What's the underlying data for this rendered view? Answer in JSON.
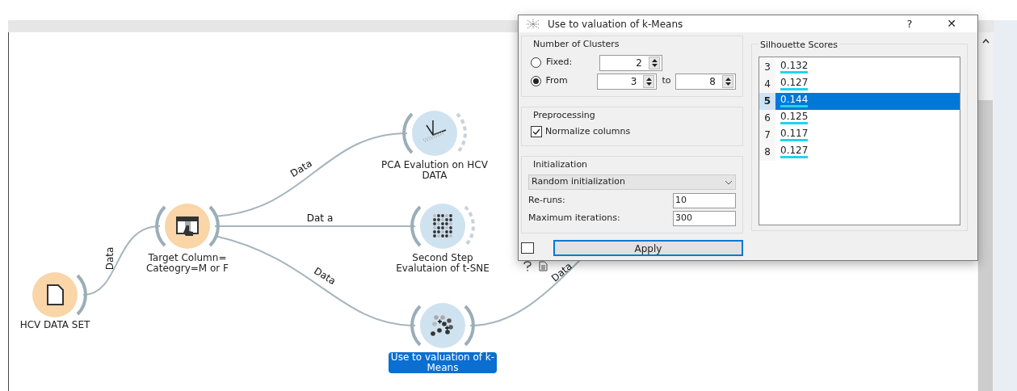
{
  "canvas": {
    "nodes": [
      {
        "kind": "file",
        "label": "HCV DATA SET",
        "selected": false
      },
      {
        "kind": "select",
        "label": "Target Column=\nCateogry=M or F",
        "selected": false
      },
      {
        "kind": "pca",
        "label": "PCA Evalution on HCV\nDATA",
        "selected": false
      },
      {
        "kind": "tsne",
        "label": "Second Step\nEvalutaion of t-SNE",
        "selected": false
      },
      {
        "kind": "kmeans",
        "label": "Use to valuation of k-\nMeans",
        "selected": true
      }
    ],
    "links": [
      {
        "label": "Data"
      },
      {
        "label": "Data"
      },
      {
        "label": "Dat a"
      },
      {
        "label": "Data"
      },
      {
        "label": "Data"
      }
    ]
  },
  "dialog": {
    "title": "Use to valuation of k-Means",
    "help": "?",
    "close": "✕",
    "clusters": {
      "title": "Number of Clusters",
      "fixed": {
        "label": "Fixed:",
        "selected": false,
        "value": "2"
      },
      "from": {
        "label": "From",
        "selected": true,
        "value": "3",
        "to_label": "to",
        "to_value": "8"
      }
    },
    "preprocessing": {
      "title": "Preprocessing",
      "normalize": {
        "label": "Normalize columns",
        "checked": true
      }
    },
    "initialization": {
      "title": "Initialization",
      "method": "Random initialization",
      "reruns": {
        "label": "Re-runs:",
        "value": "10"
      },
      "max_iterations": {
        "label": "Maximum iterations:",
        "value": "300"
      }
    },
    "auto_apply": {
      "checked": false
    },
    "apply": "Apply",
    "scores": {
      "title": "Silhouette Scores",
      "rows": [
        {
          "k": "3",
          "score": "0.132",
          "selected": false
        },
        {
          "k": "4",
          "score": "0.127",
          "selected": false
        },
        {
          "k": "5",
          "score": "0.144",
          "selected": true
        },
        {
          "k": "6",
          "score": "0.125",
          "selected": false
        },
        {
          "k": "7",
          "score": "0.117",
          "selected": false
        },
        {
          "k": "8",
          "score": "0.127",
          "selected": false
        }
      ]
    }
  }
}
